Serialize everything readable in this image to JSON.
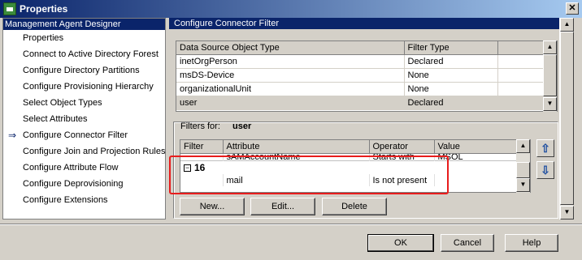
{
  "window": {
    "title": "Properties",
    "close_label": "✕"
  },
  "left_panel": {
    "header": "Management Agent Designer",
    "items": [
      {
        "label": "Properties",
        "active": false
      },
      {
        "label": "Connect to Active Directory Forest",
        "active": false
      },
      {
        "label": "Configure Directory Partitions",
        "active": false
      },
      {
        "label": "Configure Provisioning Hierarchy",
        "active": false
      },
      {
        "label": "Select Object Types",
        "active": false
      },
      {
        "label": "Select Attributes",
        "active": false
      },
      {
        "label": "Configure Connector Filter",
        "active": true
      },
      {
        "label": "Configure Join and Projection Rules",
        "active": false
      },
      {
        "label": "Configure Attribute Flow",
        "active": false
      },
      {
        "label": "Configure Deprovisioning",
        "active": false
      },
      {
        "label": "Configure Extensions",
        "active": false
      }
    ]
  },
  "right_panel": {
    "header": "Configure Connector Filter",
    "object_table": {
      "columns": [
        "Data Source Object Type",
        "Filter Type"
      ],
      "rows": [
        [
          "inetOrgPerson",
          "Declared"
        ],
        [
          "msDS-Device",
          "None"
        ],
        [
          "organizationalUnit",
          "None"
        ],
        [
          "user",
          "Declared"
        ]
      ],
      "selected_index": 3
    },
    "filters": {
      "label": "Filters for:",
      "object": "user",
      "columns": [
        "Filter",
        "Attribute",
        "Operator",
        "Value"
      ],
      "partial_row": [
        "",
        "sAMAccountName",
        "Starts with",
        "MSOL_"
      ],
      "group": {
        "toggle": "⊟",
        "number": "16"
      },
      "rows": [
        [
          "",
          "mail",
          "Is not present",
          ""
        ]
      ],
      "move_up_label": "⇧",
      "move_down_label": "⇩"
    },
    "buttons": {
      "new": "New...",
      "edit": "Edit...",
      "delete": "Delete"
    }
  },
  "footer": {
    "ok": "OK",
    "cancel": "Cancel",
    "help": "Help"
  }
}
